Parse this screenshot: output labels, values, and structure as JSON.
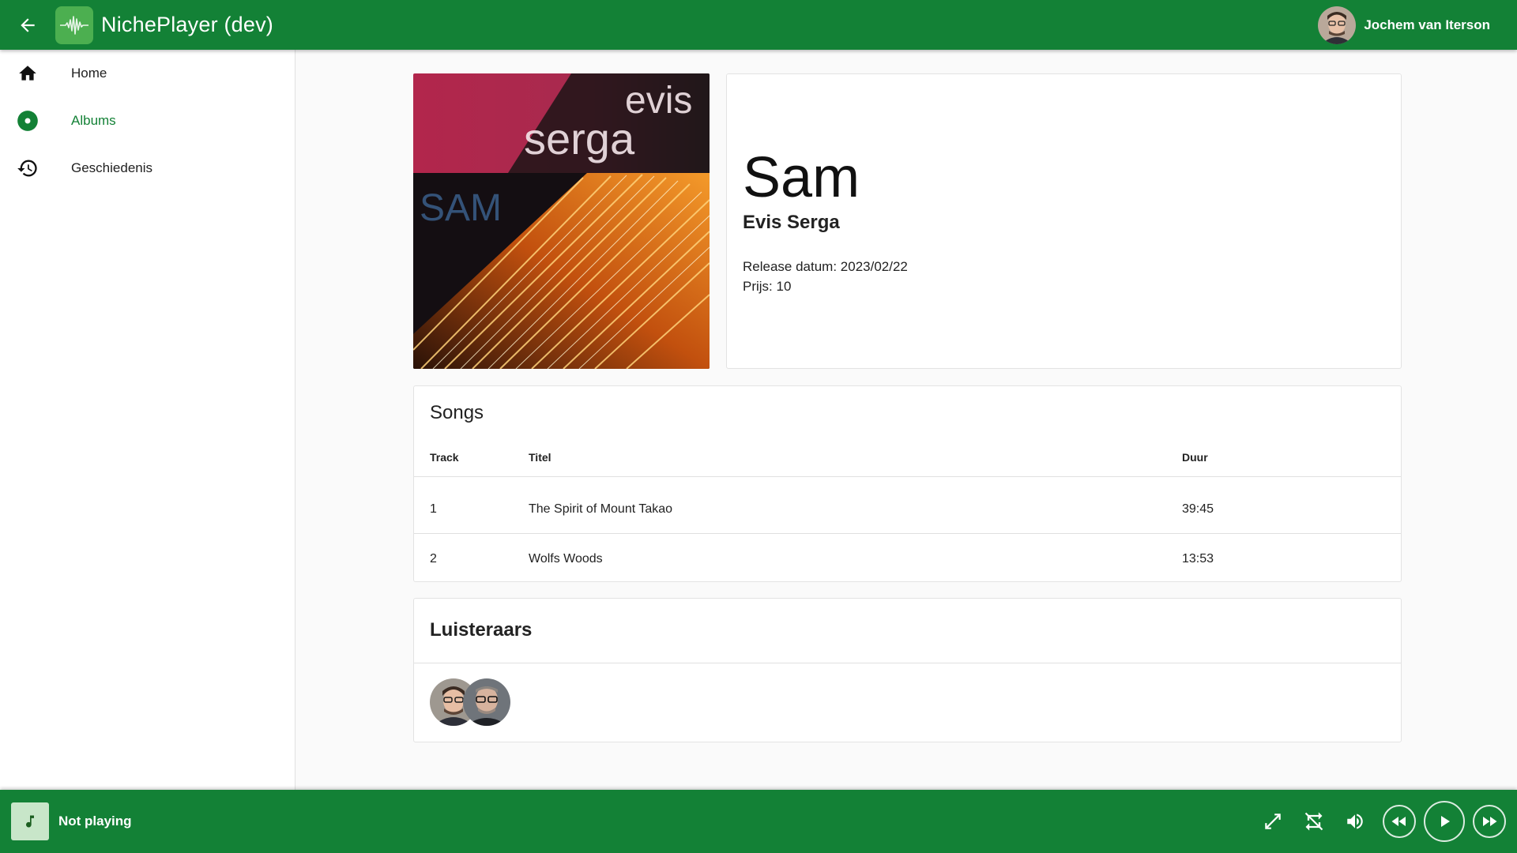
{
  "app": {
    "title": "NichePlayer (dev)",
    "accent_color": "#138136",
    "user_name": "Jochem van Iterson"
  },
  "sidebar": {
    "items": [
      {
        "label": "Home",
        "icon": "home-icon",
        "active": false
      },
      {
        "label": "Albums",
        "icon": "album-icon",
        "active": true
      },
      {
        "label": "Geschiedenis",
        "icon": "history-icon",
        "active": false
      }
    ]
  },
  "album": {
    "cover_text_top": "evis",
    "cover_text_mid": "serga",
    "cover_text_left": "SAM",
    "title": "Sam",
    "artist": "Evis Serga",
    "release_label": "Release datum: 2023/02/22",
    "price_label": "Prijs: 10"
  },
  "songs": {
    "title": "Songs",
    "columns": {
      "track": "Track",
      "title": "Titel",
      "duration": "Duur"
    },
    "rows": [
      {
        "track": "1",
        "title": "The Spirit of Mount Takao",
        "duration": "39:45"
      },
      {
        "track": "2",
        "title": "Wolfs Woods",
        "duration": "13:53"
      }
    ]
  },
  "listeners": {
    "title": "Luisteraars"
  },
  "player": {
    "status": "Not playing",
    "controls": [
      "expand-icon",
      "repeat-off-icon",
      "volume-icon",
      "rewind-icon",
      "play-icon",
      "fast-forward-icon"
    ]
  }
}
